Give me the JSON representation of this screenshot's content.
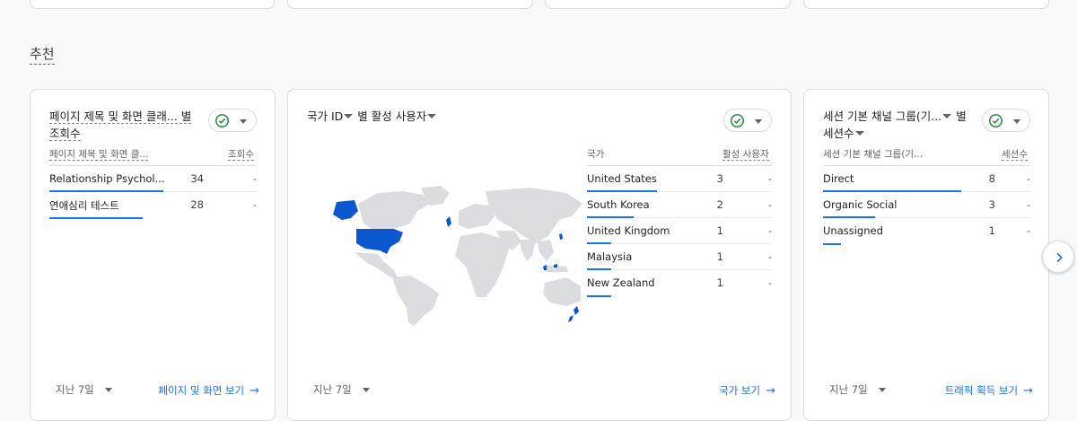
{
  "section_title": "추천",
  "cards": [
    {
      "title_line1": "페이지 제목 및 화면 클래... 별",
      "title_line2": "조회수",
      "col_label": "페이지 제목 및 화면 클...",
      "col_value": "조회수",
      "rows": [
        {
          "label": "Relationship Psychol...",
          "value": "34",
          "dash": "-",
          "share": 1.0
        },
        {
          "label": "연애심리 테스트",
          "value": "28",
          "dash": "-",
          "share": 0.82
        }
      ],
      "range": "지난 7일",
      "link": "페이지 및 화면 보기"
    },
    {
      "title_main": "국가 ID",
      "title_rest": "별 활성 사용자",
      "col_label": "국가",
      "col_value": "활성 사용자",
      "rows": [
        {
          "label": "United States",
          "value": "3",
          "dash": "-",
          "share": 1.0
        },
        {
          "label": "South Korea",
          "value": "2",
          "dash": "-",
          "share": 0.67
        },
        {
          "label": "United Kingdom",
          "value": "1",
          "dash": "-",
          "share": 0.33
        },
        {
          "label": "Malaysia",
          "value": "1",
          "dash": "-",
          "share": 0.33
        },
        {
          "label": "New Zealand",
          "value": "1",
          "dash": "-",
          "share": 0.33
        }
      ],
      "range": "지난 7일",
      "link": "국가 보기"
    },
    {
      "title_main": "세션 기본 채널 그룹(기...",
      "title_rest": "별",
      "title_line2": "세션수",
      "col_label": "세션 기본 채널 그룹(기...",
      "col_value": "세션수",
      "rows": [
        {
          "label": "Direct",
          "value": "8",
          "dash": "-",
          "share": 1.0
        },
        {
          "label": "Organic Social",
          "value": "3",
          "dash": "-",
          "share": 0.38
        },
        {
          "label": "Unassigned",
          "value": "1",
          "dash": "-",
          "share": 0.13
        }
      ],
      "range": "지난 7일",
      "link": "트래픽 획득 보기"
    }
  ],
  "colors": {
    "accent": "#1a73e8",
    "map_highlight": "#0b57d0",
    "map_base": "#dadce0",
    "check": "#188038"
  },
  "icons": [
    "check-circle-icon",
    "chevron-right-icon",
    "arrow-right-icon",
    "dropdown-icon"
  ]
}
